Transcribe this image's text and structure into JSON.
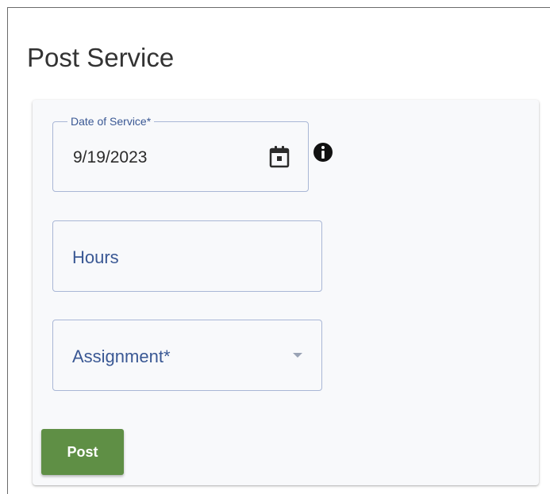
{
  "page": {
    "title": "Post Service"
  },
  "form": {
    "date_of_service": {
      "label": "Date of Service*",
      "value": "9/19/2023",
      "icon": "calendar-icon"
    },
    "info": {
      "icon": "info-icon"
    },
    "hours": {
      "placeholder": "Hours"
    },
    "assignment": {
      "placeholder": "Assignment*",
      "icon": "chevron-down-icon"
    },
    "post_button": {
      "label": "Post",
      "color": "#5f8f45"
    }
  },
  "colors": {
    "field_border": "#a9b7d6",
    "label_text": "#3a5894",
    "card_background": "#f8f9fb"
  }
}
